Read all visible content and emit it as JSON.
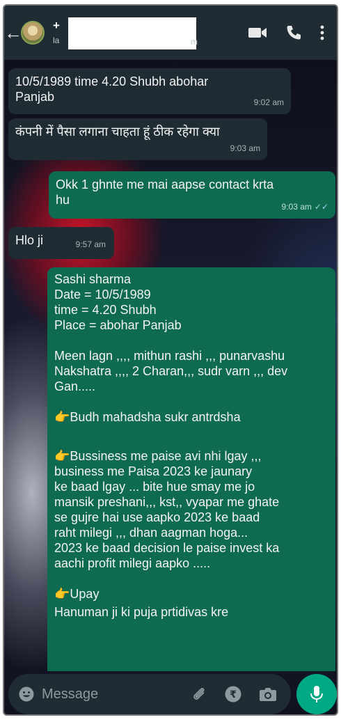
{
  "header": {
    "back_icon": "arrow-left-icon",
    "name_visible": "+",
    "status_visible": "la",
    "status_tail": "m",
    "icons": [
      "video-call-icon",
      "voice-call-icon",
      "more-options-icon"
    ]
  },
  "messages": [
    {
      "dir": "in",
      "text": "10/5/1989 time 4.20 Shubh  abohar\nPanjab",
      "time": "9:02 am"
    },
    {
      "dir": "in",
      "text": "कंपनी में पैसा लगाना चाहता हूं ठीक रहेगा क्या",
      "time": "9:03 am"
    },
    {
      "dir": "out",
      "text": "Okk 1 ghnte me mai aapse contact krta\nhu",
      "time": "9:03 am",
      "ticks": "✓✓"
    },
    {
      "dir": "in",
      "text": "Hlo ji",
      "time": "9:57 am"
    },
    {
      "dir": "out",
      "header_lines": "Sashi sharma\nDate = 10/5/1989\ntime = 4.20 Shubh\nPlace = abohar Panjab",
      "para1": "Meen lagn  ,,,, mithun rashi ,,, punarvashu\nNakshatra ,,,, 2 Charan,,, sudr varn ,,, dev\nGan.....",
      "point1": "Budh mahadsha sukr antrdsha",
      "point2_first": "Bussiness me paise avi nhi lgay ,,,",
      "point2_rest": "business me Paisa 2023 ke jaunary\nke baad lgay ... bite hue  smay me jo\nmansik preshani,,, kst,, vyapar me ghate\nse gujre  hai use aapko 2023 ke baad\nraht milegi ,,, dhan aagman hoga...\n2023 ke baad decision le paise invest ka\naachi profit milegi aapko  .....",
      "point3": "Upay",
      "last_line": "Hanuman ji ki puja prtidivas kre",
      "pointer_icon": "pointing-hand-icon"
    }
  ],
  "footer": {
    "placeholder": "Message",
    "icons": [
      "emoji-icon",
      "attach-icon",
      "rupee-payment-icon",
      "camera-icon",
      "microphone-icon"
    ]
  }
}
